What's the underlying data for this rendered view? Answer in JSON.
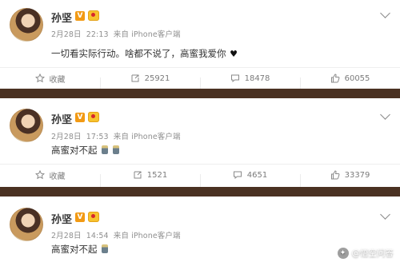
{
  "posts": [
    {
      "user": {
        "name": "孙坚",
        "verified": "V",
        "member_badge": "weibo-member-badge"
      },
      "date": "2月28日",
      "time": "22:13",
      "source": "来自 iPhone客户端",
      "text": "一切看实际行动。啥都不说了，高蜜我爱你",
      "text_emoji": "♥",
      "actions": {
        "favorite": "收藏",
        "repost": "25921",
        "comment": "18478",
        "like": "60055"
      }
    },
    {
      "user": {
        "name": "孙坚",
        "verified": "V",
        "member_badge": "weibo-member-badge"
      },
      "date": "2月28日",
      "time": "17:53",
      "source": "来自 iPhone客户端",
      "text": "高蜜对不起",
      "text_emoji": "candle-candle",
      "actions": {
        "favorite": "收藏",
        "repost": "1521",
        "comment": "4651",
        "like": "33379"
      }
    },
    {
      "user": {
        "name": "孙坚",
        "verified": "V",
        "member_badge": "weibo-member-badge"
      },
      "date": "2月28日",
      "time": "14:54",
      "source": "来自 iPhone客户端",
      "text": "高蜜对不起",
      "text_emoji": "candle"
    }
  ],
  "watermark": {
    "text": "@悟空问答",
    "icon": "wukong-qa-icon"
  },
  "colors": {
    "separator": "#4a3122",
    "vip": "#f29a14",
    "member": "#f7c32e"
  }
}
